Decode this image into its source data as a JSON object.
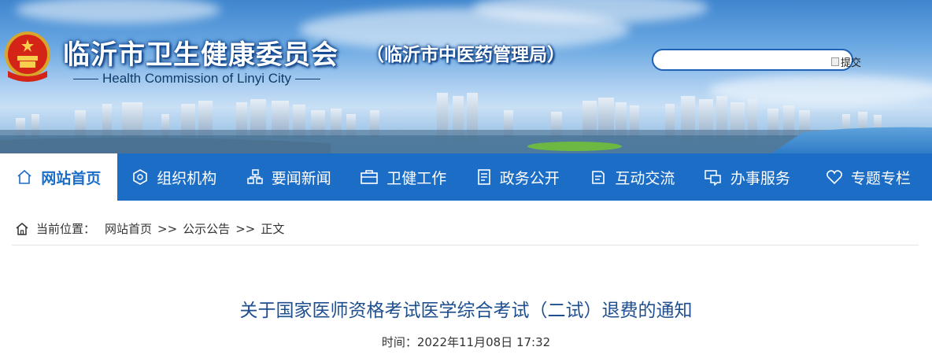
{
  "header": {
    "title": "临沂市卫生健康委员会",
    "subtitle": "（临沂市中医药管理局）",
    "english_name": "Health Commission of Linyi City",
    "search": {
      "placeholder": "",
      "value": "",
      "button_label": "提交"
    }
  },
  "nav": {
    "items": [
      {
        "label": "网站首页",
        "icon": "home-icon",
        "active": true
      },
      {
        "label": "组织机构",
        "icon": "org-icon",
        "active": false
      },
      {
        "label": "要闻新闻",
        "icon": "news-icon",
        "active": false
      },
      {
        "label": "卫健工作",
        "icon": "briefcase-icon",
        "active": false
      },
      {
        "label": "政务公开",
        "icon": "document-icon",
        "active": false
      },
      {
        "label": "互动交流",
        "icon": "chat-icon",
        "active": false
      },
      {
        "label": "办事服务",
        "icon": "service-icon",
        "active": false
      },
      {
        "label": "专题专栏",
        "icon": "heart-icon",
        "active": false
      }
    ]
  },
  "breadcrumb": {
    "prefix": "当前位置：",
    "items": [
      "网站首页",
      "公示公告",
      "正文"
    ],
    "separator": ">>"
  },
  "article": {
    "title": "关于国家医师资格考试医学综合考试（二试）退费的通知",
    "time_label": "时间：",
    "time": "2022年11月08日 17:32"
  },
  "colors": {
    "nav_bg": "#1b6dc6",
    "title_text": "#1f4f8f",
    "accent": "#1f62b5"
  }
}
